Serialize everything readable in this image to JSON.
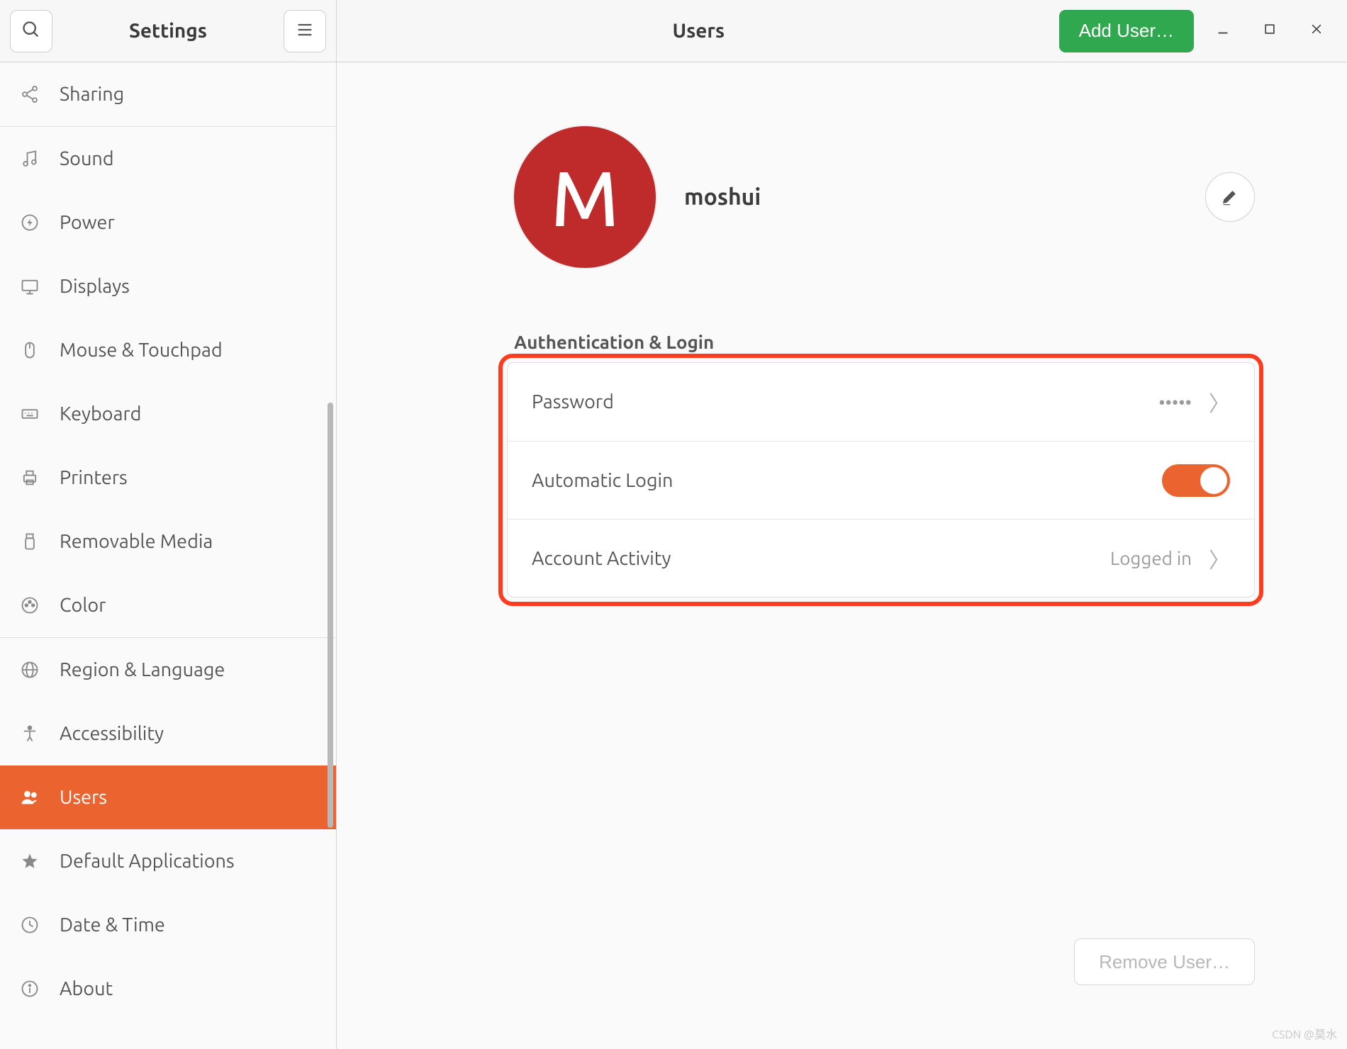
{
  "titlebar": {
    "left_title": "Settings",
    "right_title": "Users",
    "add_user_label": "Add User…"
  },
  "sidebar": {
    "items": [
      {
        "id": "sharing",
        "label": "Sharing"
      },
      {
        "id": "sound",
        "label": "Sound"
      },
      {
        "id": "power",
        "label": "Power"
      },
      {
        "id": "displays",
        "label": "Displays"
      },
      {
        "id": "mouse-touchpad",
        "label": "Mouse & Touchpad"
      },
      {
        "id": "keyboard",
        "label": "Keyboard"
      },
      {
        "id": "printers",
        "label": "Printers"
      },
      {
        "id": "removable-media",
        "label": "Removable Media"
      },
      {
        "id": "color",
        "label": "Color"
      },
      {
        "id": "region-language",
        "label": "Region & Language"
      },
      {
        "id": "accessibility",
        "label": "Accessibility"
      },
      {
        "id": "users",
        "label": "Users"
      },
      {
        "id": "default-applications",
        "label": "Default Applications"
      },
      {
        "id": "date-time",
        "label": "Date & Time"
      },
      {
        "id": "about",
        "label": "About"
      }
    ],
    "selected": "users"
  },
  "user": {
    "avatar_initial": "M",
    "avatar_color": "#bf2b2b",
    "name": "moshui"
  },
  "auth": {
    "section_title": "Authentication & Login",
    "password_label": "Password",
    "password_value": "•••••",
    "autologin_label": "Automatic Login",
    "autologin_on": true,
    "activity_label": "Account Activity",
    "activity_value": "Logged in"
  },
  "actions": {
    "remove_user_label": "Remove User…"
  },
  "colors": {
    "accent": "#eb6430",
    "primary_green": "#2fa84f"
  },
  "watermark": "CSDN @莫水"
}
